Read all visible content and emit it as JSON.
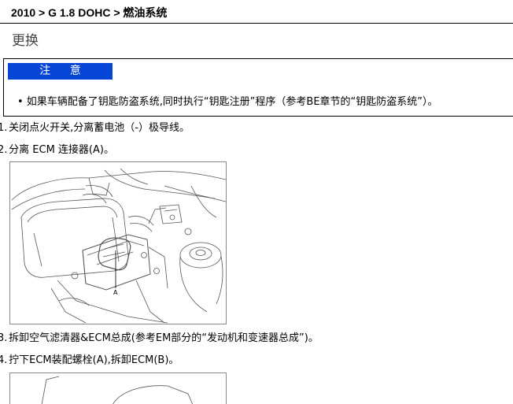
{
  "breadcrumb": "2010 > G 1.8 DOHC > 燃油系统",
  "section_title": "更换",
  "caution": {
    "badge": "注 意",
    "text": "• 如果车辆配备了钥匙防盗系统,同时执行“钥匙注册”程序（参考BE章节的“钥匙防盗系统”）。"
  },
  "steps": [
    {
      "num": "1.",
      "text": "关闭点火开关,分离蓄电池（-）极导线。"
    },
    {
      "num": "2.",
      "text": "分离  ECM 连接器(A)。"
    },
    {
      "num": "3.",
      "text": "拆卸空气滤清器&ECM总成(参考EM部分的“发动机和变速器总成”)。"
    },
    {
      "num": "4.",
      "text": "拧下ECM装配螺栓(A),拆卸ECM(B)。"
    }
  ],
  "figure1": {
    "callout": "A"
  }
}
